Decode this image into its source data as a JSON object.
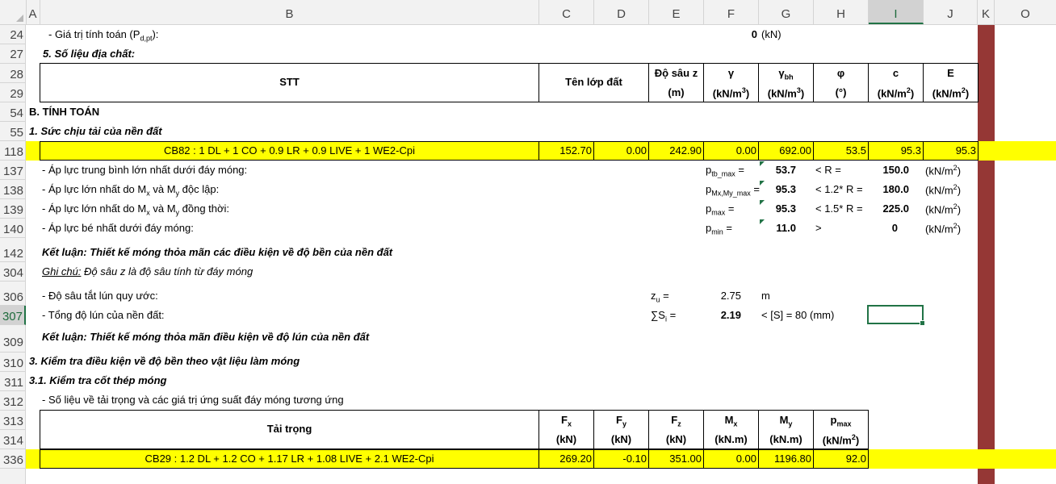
{
  "columns": [
    "A",
    "B",
    "C",
    "D",
    "E",
    "F",
    "G",
    "H",
    "I",
    "J",
    "K",
    "O"
  ],
  "selected_column": "I",
  "row_numbers": [
    "24",
    "27",
    "28",
    "29",
    "54",
    "55",
    "118",
    "137",
    "138",
    "139",
    "140",
    "142",
    "304",
    "306",
    "307",
    "309",
    "310",
    "311",
    "312",
    "313",
    "314",
    "336"
  ],
  "selected_row": "307",
  "rows": {
    "r24": {
      "label_pre": "- Giá trị tính toán (P",
      "label_sub": "d,pt",
      "label_post": "):",
      "value": "0",
      "unit": "(kN)"
    },
    "r27": {
      "text": "5. Số liệu địa chất:"
    },
    "geo_header": {
      "stt": "STT",
      "ten": "Tên lớp đất",
      "dosau": "Độ sâu z",
      "dosau_unit": "(m)",
      "gamma": "γ",
      "gamma_unit_pre": "(kN/m",
      "gamma_unit_sup": "3",
      "gamma_unit_post": ")",
      "gammabh": "γ",
      "gammabh_sub": "bh",
      "gammabh_unit_pre": "(kN/m",
      "gammabh_unit_sup": "3",
      "gammabh_unit_post": ")",
      "phi": "φ",
      "phi_unit": "(°)",
      "c": "c",
      "c_unit_pre": "(kN/m",
      "c_unit_sup": "2",
      "c_unit_post": ")",
      "e": "E",
      "e_unit_pre": "(kN/m",
      "e_unit_sup": "2",
      "e_unit_post": ")"
    },
    "r54": {
      "text": "B. TÍNH TOÁN"
    },
    "r55": {
      "text": "1. Sức chịu tải của nền đất"
    },
    "r118": {
      "combo": "CB82 : 1 DL + 1 CO + 0.9 LR + 0.9 LIVE + 1 WE2-Cpi",
      "c": "152.70",
      "d": "0.00",
      "e": "242.90",
      "f": "0.00",
      "g": "692.00",
      "h": "53.5",
      "i": "95.3",
      "j": "95.3"
    },
    "r137": {
      "label": "- Áp lực trung bình lớn nhất dưới đáy móng:",
      "sym": "p",
      "sym_sub": "tb_max",
      "sym_post": " =",
      "value": "53.7",
      "cmp": "< R =",
      "limit": "150.0",
      "unit_pre": "(kN/m",
      "unit_sup": "2",
      "unit_post": ")"
    },
    "r138": {
      "label_pre": "- Áp lực lớn nhất do M",
      "label_sub1": "x",
      "label_mid": " và M",
      "label_sub2": "y",
      "label_post": " độc lập:",
      "sym": "p",
      "sym_sub": "Mx,My_max",
      "sym_post": " =",
      "value": "95.3",
      "cmp": "< 1.2* R =",
      "limit": "180.0",
      "unit_pre": "(kN/m",
      "unit_sup": "2",
      "unit_post": ")"
    },
    "r139": {
      "label_pre": "- Áp lực lớn nhất do M",
      "label_sub1": "x",
      "label_mid": " và M",
      "label_sub2": "y",
      "label_post": " đồng thời:",
      "sym": "p",
      "sym_sub": "max",
      "sym_post": " =",
      "value": "95.3",
      "cmp": "< 1.5* R =",
      "limit": "225.0",
      "unit_pre": "(kN/m",
      "unit_sup": "2",
      "unit_post": ")"
    },
    "r140": {
      "label": "- Áp lực bé nhất dưới đáy móng:",
      "sym": "p",
      "sym_sub": "min",
      "sym_post": " =",
      "value": "11.0",
      "cmp": ">",
      "limit": "0",
      "unit_pre": "(kN/m",
      "unit_sup": "2",
      "unit_post": ")"
    },
    "r142": {
      "text": "Kết luận: Thiết kế móng thỏa mãn các điều kiện về độ bền của nền đất"
    },
    "r304": {
      "note_label": "Ghi chú:",
      "note": " Độ sâu z là độ sâu tính từ đáy móng"
    },
    "r306": {
      "label": "- Độ sâu tắt lún quy ước:",
      "sym": "z",
      "sym_sub": "u",
      "sym_post": " =",
      "value": "2.75",
      "unit": "m"
    },
    "r307": {
      "label": "- Tổng độ lún của nền đất:",
      "sym": "∑S",
      "sym_sub": "i",
      "sym_post": " =",
      "value": "2.19",
      "cmp": "< [S] = 80 (mm)"
    },
    "r309": {
      "text": "Kết luận: Thiết kế móng thỏa mãn điều kiện về độ lún của nền đất"
    },
    "r310": {
      "text": "3. Kiểm tra điều kiện về độ bền theo vật liệu làm móng"
    },
    "r311": {
      "text": "3.1. Kiểm tra cốt thép móng"
    },
    "r312": {
      "text": "- Số liệu về tải trọng và các giá trị ứng suất đáy móng tương ứng"
    },
    "load_header": {
      "title": "Tải trọng",
      "fx": "F",
      "fx_sub": "x",
      "fy": "F",
      "fy_sub": "y",
      "fz": "F",
      "fz_sub": "z",
      "mx": "M",
      "mx_sub": "x",
      "my": "M",
      "my_sub": "y",
      "pmax": "p",
      "pmax_sub": "max",
      "u_kn": "(kN)",
      "u_knm": "(kN.m)",
      "u_p_pre": "(kN/m",
      "u_p_sup": "2",
      "u_p_post": ")"
    },
    "r336": {
      "combo": "CB29 : 1.2 DL + 1.2 CO + 1.17 LR + 1.08 LIVE + 2.1 WE2-Cpi",
      "c": "269.20",
      "d": "-0.10",
      "e": "351.00",
      "f": "0.00",
      "g": "1196.80",
      "h": "92.0"
    }
  },
  "colors": {
    "highlight": "#ffff00",
    "marker_column": "#953735",
    "selection": "#217346"
  }
}
